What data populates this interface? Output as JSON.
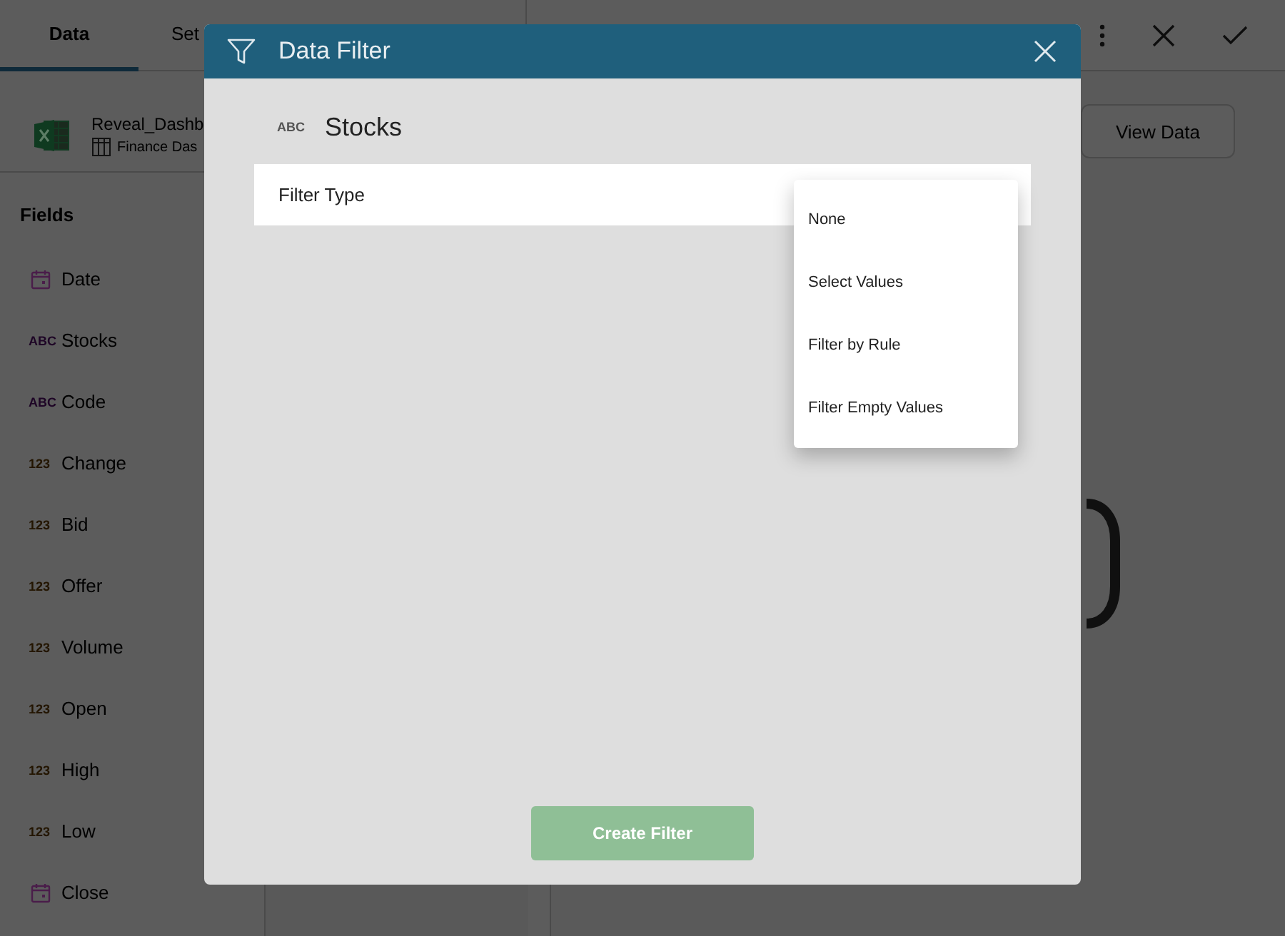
{
  "tabs": [
    {
      "label": "Data",
      "selected": true
    },
    {
      "label": "Set",
      "selected": false
    }
  ],
  "source": {
    "name": "Reveal_Dashb",
    "sheet": "Finance Das"
  },
  "fields_title": "Fields",
  "fields": [
    {
      "kind": "date",
      "label": "Date"
    },
    {
      "kind": "text",
      "icon_text": "ABC",
      "label": "Stocks"
    },
    {
      "kind": "text",
      "icon_text": "ABC",
      "label": "Code"
    },
    {
      "kind": "number",
      "icon_text": "123",
      "label": "Change"
    },
    {
      "kind": "number",
      "icon_text": "123",
      "label": "Bid"
    },
    {
      "kind": "number",
      "icon_text": "123",
      "label": "Offer"
    },
    {
      "kind": "number",
      "icon_text": "123",
      "label": "Volume"
    },
    {
      "kind": "number",
      "icon_text": "123",
      "label": "Open"
    },
    {
      "kind": "number",
      "icon_text": "123",
      "label": "High"
    },
    {
      "kind": "number",
      "icon_text": "123",
      "label": "Low"
    },
    {
      "kind": "date",
      "label": "Close"
    }
  ],
  "view_data_button": "View Data",
  "dialog": {
    "title": "Data Filter",
    "field_type": "ABC",
    "field_name": "Stocks",
    "filter_type_label": "Filter Type",
    "filter_type_options": [
      "None",
      "Select Values",
      "Filter by Rule",
      "Filter Empty Values"
    ],
    "create_button": {
      "label": "Create Filter",
      "disabled": true
    }
  }
}
